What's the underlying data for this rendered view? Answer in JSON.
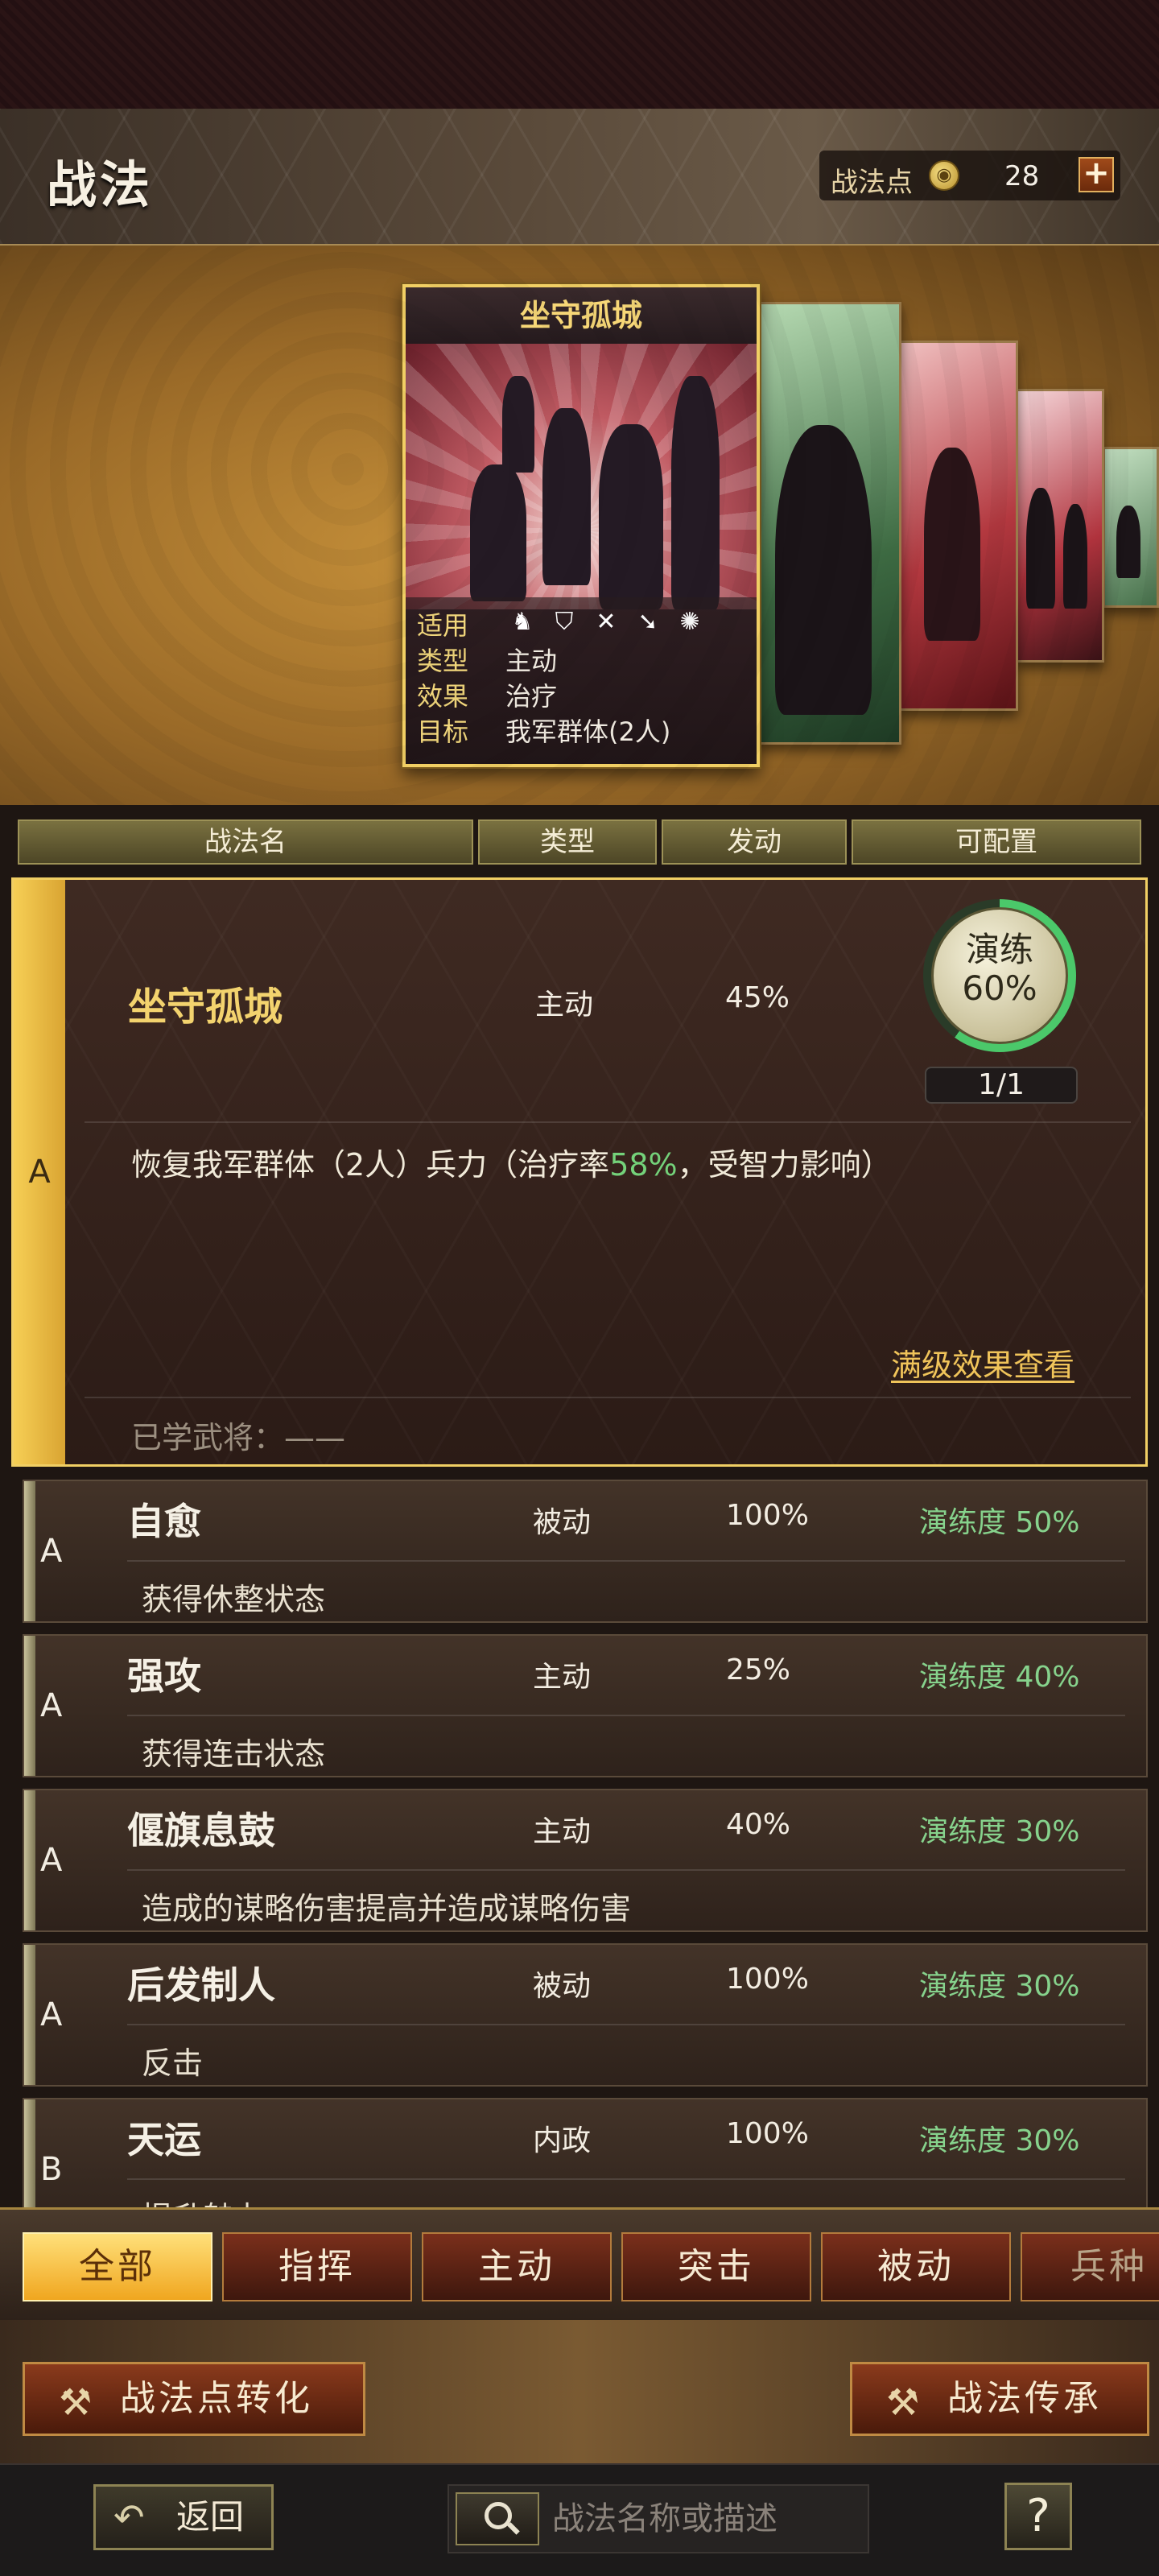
{
  "header": {
    "title": "战法",
    "points_label": "战法点",
    "points_value": "28",
    "add_button": "+"
  },
  "featured_card": {
    "title": "坐守孤城",
    "rows": [
      {
        "key": "适用",
        "icons": [
          "cavalry-icon",
          "shield-icon",
          "crossed-arrows-icon",
          "spear-icon",
          "wheel-icon"
        ]
      },
      {
        "key": "类型",
        "value": "主动"
      },
      {
        "key": "效果",
        "value": "治疗"
      },
      {
        "key": "目标",
        "value": "我军群体(2人)"
      }
    ]
  },
  "columns": [
    "战法名",
    "类型",
    "发动",
    "可配置"
  ],
  "selected": {
    "grade": "A",
    "name": "坐守孤城",
    "type": "主动",
    "rate": "45%",
    "practice_label": "演练",
    "practice_value": "60%",
    "practice_progress": 0.6,
    "count": "1/1",
    "desc_pre": "恢复我军群体（2人）兵力（治疗率",
    "desc_highlight": "58%",
    "desc_post": "，受智力影响）",
    "max_link": "满级效果查看",
    "learned": "已学武将：——"
  },
  "items": [
    {
      "grade": "A",
      "name": "自愈",
      "type": "被动",
      "rate": "100%",
      "practice": "演练度 50%",
      "desc": "获得休整状态"
    },
    {
      "grade": "A",
      "name": "强攻",
      "type": "主动",
      "rate": "25%",
      "practice": "演练度 40%",
      "desc": "获得连击状态"
    },
    {
      "grade": "A",
      "name": "偃旗息鼓",
      "type": "主动",
      "rate": "40%",
      "practice": "演练度 30%",
      "desc": "造成的谋略伤害提高并造成谋略伤害"
    },
    {
      "grade": "A",
      "name": "后发制人",
      "type": "被动",
      "rate": "100%",
      "practice": "演练度 30%",
      "desc": "反击"
    },
    {
      "grade": "B",
      "name": "天运",
      "type": "内政",
      "rate": "100%",
      "practice": "演练度 30%",
      "desc": "提升魅力"
    }
  ],
  "tabs": [
    "全部",
    "指挥",
    "主动",
    "突击",
    "被动",
    "兵种"
  ],
  "actions": {
    "convert": "战法点转化",
    "inherit": "战法传承"
  },
  "footer": {
    "back": "返回",
    "search_placeholder": "战法名称或描述",
    "help": "?"
  },
  "colors": {
    "accent_gold": "#f1cf64",
    "highlight_green": "#74d27a",
    "tab_active": "#f0a61f"
  }
}
